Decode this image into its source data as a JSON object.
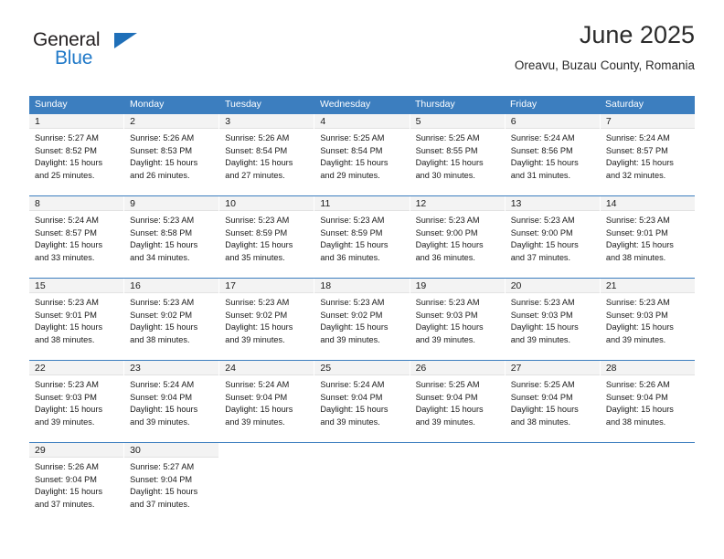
{
  "brand": {
    "name_part1": "General",
    "name_part2": "Blue",
    "triangle_icon": "triangle-icon",
    "accent_color": "#2079c8"
  },
  "header": {
    "title": "June 2025",
    "subtitle": "Oreavu, Buzau County, Romania"
  },
  "calendar": {
    "header_color": "#3c7ebf",
    "weekdays": [
      "Sunday",
      "Monday",
      "Tuesday",
      "Wednesday",
      "Thursday",
      "Friday",
      "Saturday"
    ],
    "weeks": [
      [
        {
          "day": "1",
          "sunrise": "Sunrise: 5:27 AM",
          "sunset": "Sunset: 8:52 PM",
          "daylight1": "Daylight: 15 hours",
          "daylight2": "and 25 minutes."
        },
        {
          "day": "2",
          "sunrise": "Sunrise: 5:26 AM",
          "sunset": "Sunset: 8:53 PM",
          "daylight1": "Daylight: 15 hours",
          "daylight2": "and 26 minutes."
        },
        {
          "day": "3",
          "sunrise": "Sunrise: 5:26 AM",
          "sunset": "Sunset: 8:54 PM",
          "daylight1": "Daylight: 15 hours",
          "daylight2": "and 27 minutes."
        },
        {
          "day": "4",
          "sunrise": "Sunrise: 5:25 AM",
          "sunset": "Sunset: 8:54 PM",
          "daylight1": "Daylight: 15 hours",
          "daylight2": "and 29 minutes."
        },
        {
          "day": "5",
          "sunrise": "Sunrise: 5:25 AM",
          "sunset": "Sunset: 8:55 PM",
          "daylight1": "Daylight: 15 hours",
          "daylight2": "and 30 minutes."
        },
        {
          "day": "6",
          "sunrise": "Sunrise: 5:24 AM",
          "sunset": "Sunset: 8:56 PM",
          "daylight1": "Daylight: 15 hours",
          "daylight2": "and 31 minutes."
        },
        {
          "day": "7",
          "sunrise": "Sunrise: 5:24 AM",
          "sunset": "Sunset: 8:57 PM",
          "daylight1": "Daylight: 15 hours",
          "daylight2": "and 32 minutes."
        }
      ],
      [
        {
          "day": "8",
          "sunrise": "Sunrise: 5:24 AM",
          "sunset": "Sunset: 8:57 PM",
          "daylight1": "Daylight: 15 hours",
          "daylight2": "and 33 minutes."
        },
        {
          "day": "9",
          "sunrise": "Sunrise: 5:23 AM",
          "sunset": "Sunset: 8:58 PM",
          "daylight1": "Daylight: 15 hours",
          "daylight2": "and 34 minutes."
        },
        {
          "day": "10",
          "sunrise": "Sunrise: 5:23 AM",
          "sunset": "Sunset: 8:59 PM",
          "daylight1": "Daylight: 15 hours",
          "daylight2": "and 35 minutes."
        },
        {
          "day": "11",
          "sunrise": "Sunrise: 5:23 AM",
          "sunset": "Sunset: 8:59 PM",
          "daylight1": "Daylight: 15 hours",
          "daylight2": "and 36 minutes."
        },
        {
          "day": "12",
          "sunrise": "Sunrise: 5:23 AM",
          "sunset": "Sunset: 9:00 PM",
          "daylight1": "Daylight: 15 hours",
          "daylight2": "and 36 minutes."
        },
        {
          "day": "13",
          "sunrise": "Sunrise: 5:23 AM",
          "sunset": "Sunset: 9:00 PM",
          "daylight1": "Daylight: 15 hours",
          "daylight2": "and 37 minutes."
        },
        {
          "day": "14",
          "sunrise": "Sunrise: 5:23 AM",
          "sunset": "Sunset: 9:01 PM",
          "daylight1": "Daylight: 15 hours",
          "daylight2": "and 38 minutes."
        }
      ],
      [
        {
          "day": "15",
          "sunrise": "Sunrise: 5:23 AM",
          "sunset": "Sunset: 9:01 PM",
          "daylight1": "Daylight: 15 hours",
          "daylight2": "and 38 minutes."
        },
        {
          "day": "16",
          "sunrise": "Sunrise: 5:23 AM",
          "sunset": "Sunset: 9:02 PM",
          "daylight1": "Daylight: 15 hours",
          "daylight2": "and 38 minutes."
        },
        {
          "day": "17",
          "sunrise": "Sunrise: 5:23 AM",
          "sunset": "Sunset: 9:02 PM",
          "daylight1": "Daylight: 15 hours",
          "daylight2": "and 39 minutes."
        },
        {
          "day": "18",
          "sunrise": "Sunrise: 5:23 AM",
          "sunset": "Sunset: 9:02 PM",
          "daylight1": "Daylight: 15 hours",
          "daylight2": "and 39 minutes."
        },
        {
          "day": "19",
          "sunrise": "Sunrise: 5:23 AM",
          "sunset": "Sunset: 9:03 PM",
          "daylight1": "Daylight: 15 hours",
          "daylight2": "and 39 minutes."
        },
        {
          "day": "20",
          "sunrise": "Sunrise: 5:23 AM",
          "sunset": "Sunset: 9:03 PM",
          "daylight1": "Daylight: 15 hours",
          "daylight2": "and 39 minutes."
        },
        {
          "day": "21",
          "sunrise": "Sunrise: 5:23 AM",
          "sunset": "Sunset: 9:03 PM",
          "daylight1": "Daylight: 15 hours",
          "daylight2": "and 39 minutes."
        }
      ],
      [
        {
          "day": "22",
          "sunrise": "Sunrise: 5:23 AM",
          "sunset": "Sunset: 9:03 PM",
          "daylight1": "Daylight: 15 hours",
          "daylight2": "and 39 minutes."
        },
        {
          "day": "23",
          "sunrise": "Sunrise: 5:24 AM",
          "sunset": "Sunset: 9:04 PM",
          "daylight1": "Daylight: 15 hours",
          "daylight2": "and 39 minutes."
        },
        {
          "day": "24",
          "sunrise": "Sunrise: 5:24 AM",
          "sunset": "Sunset: 9:04 PM",
          "daylight1": "Daylight: 15 hours",
          "daylight2": "and 39 minutes."
        },
        {
          "day": "25",
          "sunrise": "Sunrise: 5:24 AM",
          "sunset": "Sunset: 9:04 PM",
          "daylight1": "Daylight: 15 hours",
          "daylight2": "and 39 minutes."
        },
        {
          "day": "26",
          "sunrise": "Sunrise: 5:25 AM",
          "sunset": "Sunset: 9:04 PM",
          "daylight1": "Daylight: 15 hours",
          "daylight2": "and 39 minutes."
        },
        {
          "day": "27",
          "sunrise": "Sunrise: 5:25 AM",
          "sunset": "Sunset: 9:04 PM",
          "daylight1": "Daylight: 15 hours",
          "daylight2": "and 38 minutes."
        },
        {
          "day": "28",
          "sunrise": "Sunrise: 5:26 AM",
          "sunset": "Sunset: 9:04 PM",
          "daylight1": "Daylight: 15 hours",
          "daylight2": "and 38 minutes."
        }
      ],
      [
        {
          "day": "29",
          "sunrise": "Sunrise: 5:26 AM",
          "sunset": "Sunset: 9:04 PM",
          "daylight1": "Daylight: 15 hours",
          "daylight2": "and 37 minutes."
        },
        {
          "day": "30",
          "sunrise": "Sunrise: 5:27 AM",
          "sunset": "Sunset: 9:04 PM",
          "daylight1": "Daylight: 15 hours",
          "daylight2": "and 37 minutes."
        },
        {
          "day": "",
          "sunrise": "",
          "sunset": "",
          "daylight1": "",
          "daylight2": ""
        },
        {
          "day": "",
          "sunrise": "",
          "sunset": "",
          "daylight1": "",
          "daylight2": ""
        },
        {
          "day": "",
          "sunrise": "",
          "sunset": "",
          "daylight1": "",
          "daylight2": ""
        },
        {
          "day": "",
          "sunrise": "",
          "sunset": "",
          "daylight1": "",
          "daylight2": ""
        },
        {
          "day": "",
          "sunrise": "",
          "sunset": "",
          "daylight1": "",
          "daylight2": ""
        }
      ]
    ]
  }
}
